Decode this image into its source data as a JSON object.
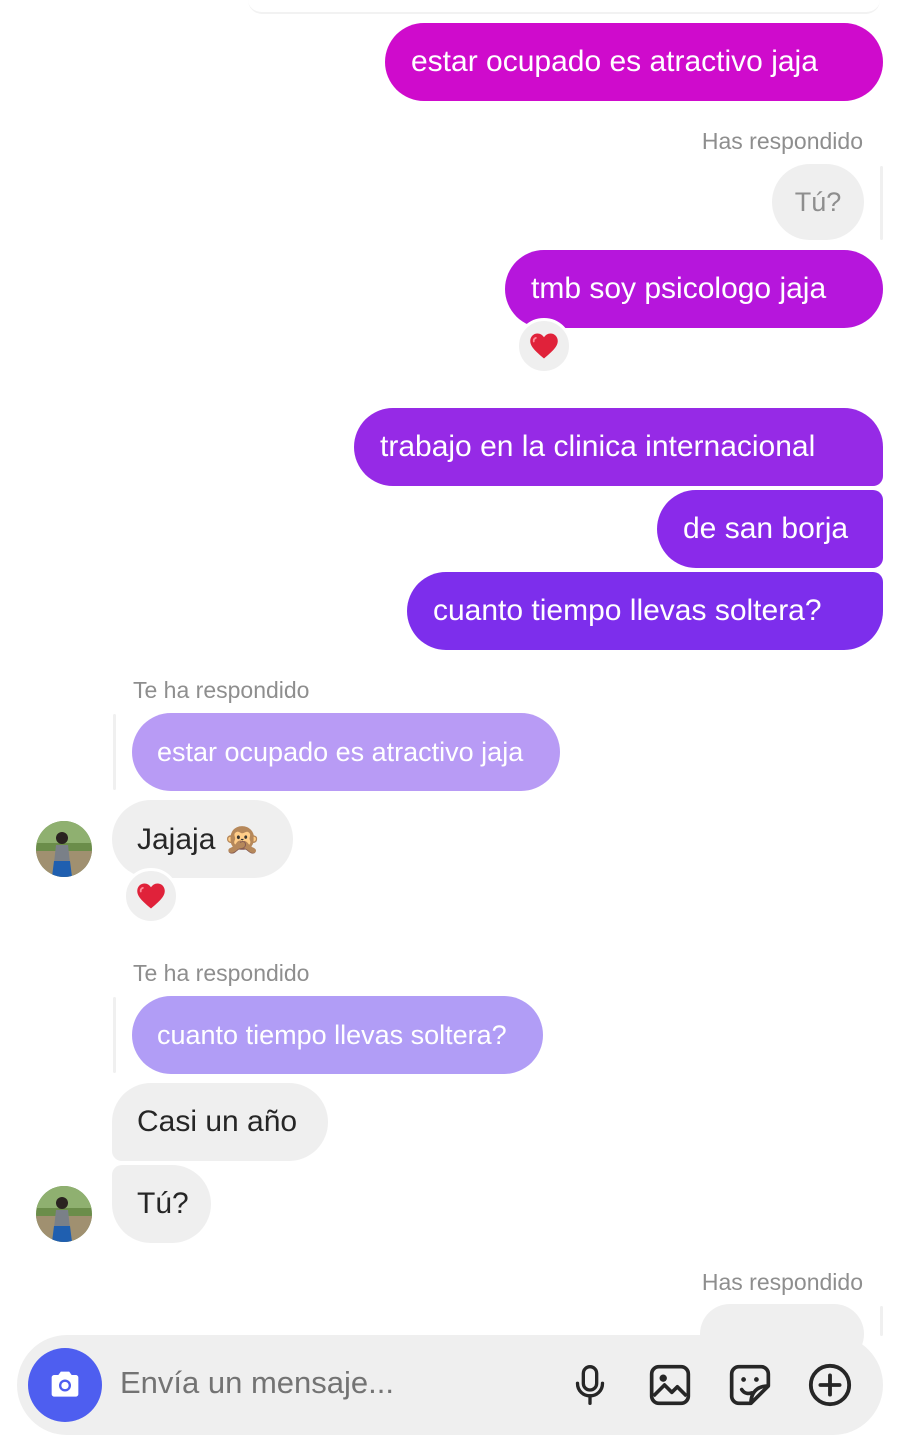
{
  "conversation": {
    "sent_1": "estar ocupado es atractivo jaja",
    "reply_label_out_1": "Has respondido",
    "reply_quote_out_1": "Tú?",
    "sent_2": "tmb soy psicologo jaja",
    "reaction_1": "heart-emoji",
    "sent_3": "trabajo en la clinica internacional",
    "sent_4": "de san borja",
    "sent_5": "cuanto tiempo llevas soltera?",
    "reply_label_in_1": "Te ha respondido",
    "reply_quote_in_1": "estar ocupado es atractivo jaja",
    "received_1": "Jajaja 🙊",
    "reaction_2": "heart-emoji",
    "reply_label_in_2": "Te ha respondido",
    "reply_quote_in_2": "cuanto tiempo llevas soltera?",
    "received_2": "Casi un año",
    "received_3": "Tú?",
    "reply_label_out_2": "Has respondido"
  },
  "composer": {
    "placeholder": "Envía un mensaje...",
    "icons": [
      "camera-icon",
      "microphone-icon",
      "gallery-icon",
      "sticker-icon",
      "plus-circle-icon"
    ]
  },
  "colors": {
    "sent_gradient": [
      "#cf0bcc",
      "#a61ee0",
      "#8628ea",
      "#7c2eec"
    ],
    "received_bg": "#efefef",
    "reply_quote_in": "#b79cf5",
    "camera_button": "#4e5ef0",
    "composer_bg": "#efefef"
  }
}
